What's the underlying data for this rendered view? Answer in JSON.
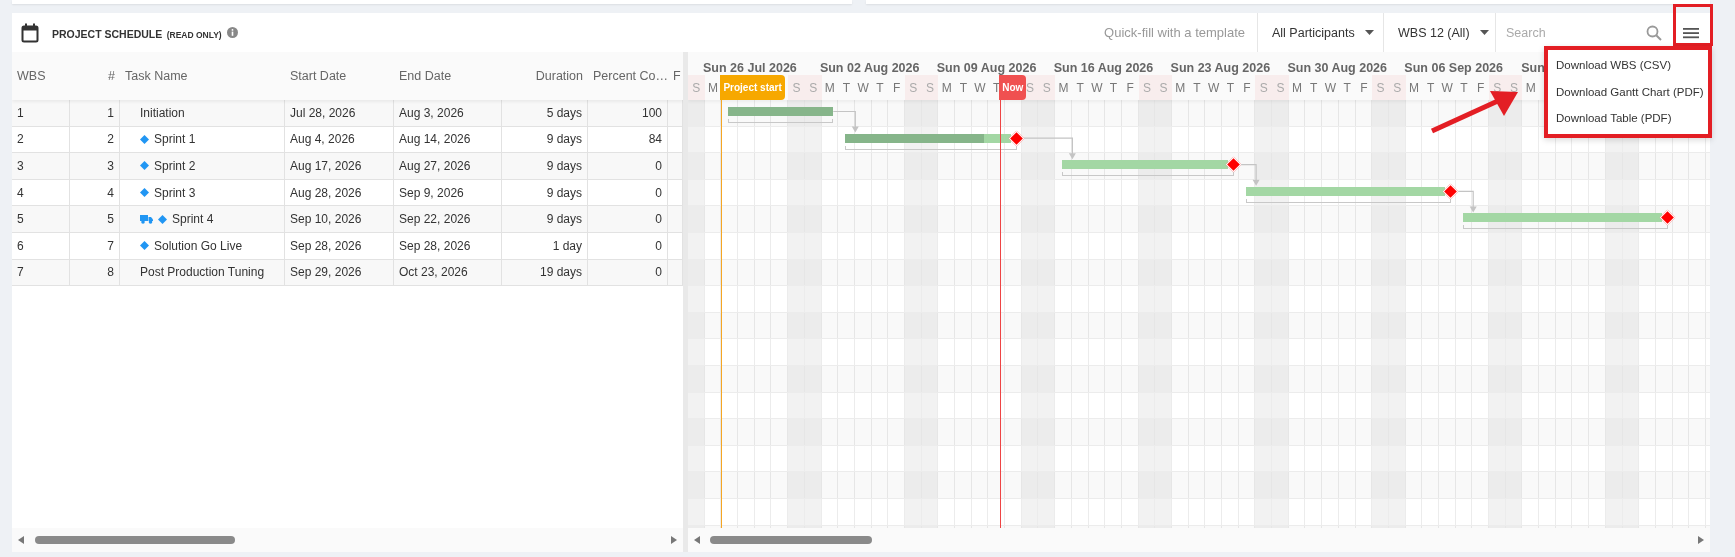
{
  "header": {
    "title": "PROJECT SCHEDULE",
    "subtitle": "(READ ONLY)",
    "template_link": "Quick-fill with a template",
    "filters": [
      {
        "label": "All Participants"
      },
      {
        "label": "WBS 12 (All)"
      }
    ],
    "search": {
      "placeholder": "Search"
    }
  },
  "menu": {
    "items": [
      "Download WBS (CSV)",
      "Download Gantt Chart (PDF)",
      "Download Table (PDF)"
    ]
  },
  "table": {
    "columns": [
      "WBS",
      "#",
      "Task Name",
      "Start Date",
      "End Date",
      "Duration",
      "Percent Co…",
      "F"
    ],
    "rows": [
      {
        "wbs": "1",
        "number": "1",
        "name": "Initiation",
        "truck_icon": false,
        "diamond_icon": false,
        "start": "Jul 28, 2026",
        "end": "Aug 3, 2026",
        "duration": "5 days",
        "percent": "100"
      },
      {
        "wbs": "2",
        "number": "2",
        "name": "Sprint 1",
        "truck_icon": false,
        "diamond_icon": true,
        "start": "Aug 4, 2026",
        "end": "Aug 14, 2026",
        "duration": "9 days",
        "percent": "84"
      },
      {
        "wbs": "3",
        "number": "3",
        "name": "Sprint 2",
        "truck_icon": false,
        "diamond_icon": true,
        "start": "Aug 17, 2026",
        "end": "Aug 27, 2026",
        "duration": "9 days",
        "percent": "0"
      },
      {
        "wbs": "4",
        "number": "4",
        "name": "Sprint 3",
        "truck_icon": false,
        "diamond_icon": true,
        "start": "Aug 28, 2026",
        "end": "Sep 9, 2026",
        "duration": "9 days",
        "percent": "0"
      },
      {
        "wbs": "5",
        "number": "5",
        "name": "Sprint 4",
        "truck_icon": true,
        "diamond_icon": true,
        "start": "Sep 10, 2026",
        "end": "Sep 22, 2026",
        "duration": "9 days",
        "percent": "0"
      },
      {
        "wbs": "6",
        "number": "7",
        "name": "Solution Go Live",
        "truck_icon": false,
        "diamond_icon": true,
        "start": "Sep 28, 2026",
        "end": "Sep 28, 2026",
        "duration": "1 day",
        "percent": "0"
      },
      {
        "wbs": "7",
        "number": "8",
        "name": "Post Production Tuning",
        "truck_icon": false,
        "diamond_icon": false,
        "start": "Sep 29, 2026",
        "end": "Oct 23, 2026",
        "duration": "19 days",
        "percent": "0"
      }
    ]
  },
  "gantt": {
    "weeks": [
      "Sun 26 Jul 2026",
      "Sun 02 Aug 2026",
      "Sun 09 Aug 2026",
      "Sun 16 Aug 2026",
      "Sun 23 Aug 2026",
      "Sun 30 Aug 2026",
      "Sun 06 Sep 2026",
      "Sun"
    ],
    "days": [
      {
        "letter": "S",
        "weekend": true
      },
      {
        "letter": "M",
        "weekend": false
      },
      {
        "weekend": false
      },
      {
        "weekend": false
      },
      {
        "weekend": false
      },
      {
        "weekend": false
      },
      {
        "letter": "S",
        "weekend": true
      },
      {
        "letter": "S",
        "weekend": true
      },
      {
        "letter": "M",
        "weekend": false
      },
      {
        "letter": "T",
        "weekend": false
      },
      {
        "letter": "W",
        "weekend": false
      },
      {
        "letter": "T",
        "weekend": false
      },
      {
        "letter": "F",
        "weekend": false
      },
      {
        "letter": "S",
        "weekend": true
      },
      {
        "letter": "S",
        "weekend": true
      },
      {
        "letter": "M",
        "weekend": false
      },
      {
        "letter": "T",
        "weekend": false
      },
      {
        "letter": "W",
        "weekend": false
      },
      {
        "letter": "T",
        "weekend": false
      },
      {
        "weekend": false
      },
      {
        "letter": "S",
        "weekend": true
      },
      {
        "letter": "S",
        "weekend": true
      },
      {
        "letter": "M",
        "weekend": false
      },
      {
        "letter": "T",
        "weekend": false
      },
      {
        "letter": "W",
        "weekend": false
      },
      {
        "letter": "T",
        "weekend": false
      },
      {
        "letter": "F",
        "weekend": false
      },
      {
        "letter": "S",
        "weekend": true
      },
      {
        "letter": "S",
        "weekend": true
      },
      {
        "letter": "M",
        "weekend": false
      },
      {
        "letter": "T",
        "weekend": false
      },
      {
        "letter": "W",
        "weekend": false
      },
      {
        "letter": "T",
        "weekend": false
      },
      {
        "letter": "F",
        "weekend": false
      },
      {
        "letter": "S",
        "weekend": true
      },
      {
        "letter": "S",
        "weekend": true
      },
      {
        "letter": "M",
        "weekend": false
      },
      {
        "letter": "T",
        "weekend": false
      },
      {
        "letter": "W",
        "weekend": false
      },
      {
        "letter": "T",
        "weekend": false
      },
      {
        "letter": "F",
        "weekend": false
      },
      {
        "letter": "S",
        "weekend": true
      },
      {
        "letter": "S",
        "weekend": true
      },
      {
        "letter": "M",
        "weekend": false
      },
      {
        "letter": "T",
        "weekend": false
      },
      {
        "letter": "W",
        "weekend": false
      },
      {
        "letter": "T",
        "weekend": false
      },
      {
        "letter": "F",
        "weekend": false
      },
      {
        "letter": "S",
        "weekend": true
      },
      {
        "letter": "S",
        "weekend": true
      },
      {
        "letter": "M",
        "weekend": false
      },
      {
        "weekend": false
      },
      {
        "weekend": false
      },
      {
        "weekend": false
      },
      {
        "weekend": false
      },
      {
        "weekend": true
      },
      {
        "weekend": true
      },
      {
        "weekend": false
      },
      {
        "weekend": false
      },
      {
        "weekend": false
      },
      {
        "weekend": false
      }
    ],
    "markers": [
      {
        "kind": "start",
        "label": "Project start"
      },
      {
        "kind": "now",
        "label": "Now"
      }
    ],
    "bars": [
      {
        "level": 1,
        "end_diamond": false,
        "linked_to_next": true
      },
      {
        "level": 0.84,
        "end_diamond": true,
        "linked_to_next": true
      },
      {
        "level": 0,
        "end_diamond": true,
        "linked_to_next": true
      },
      {
        "level": 0,
        "end_diamond": true,
        "linked_to_next": true
      },
      {
        "level": 0,
        "end_diamond": true,
        "linked_to_next": false
      }
    ]
  }
}
